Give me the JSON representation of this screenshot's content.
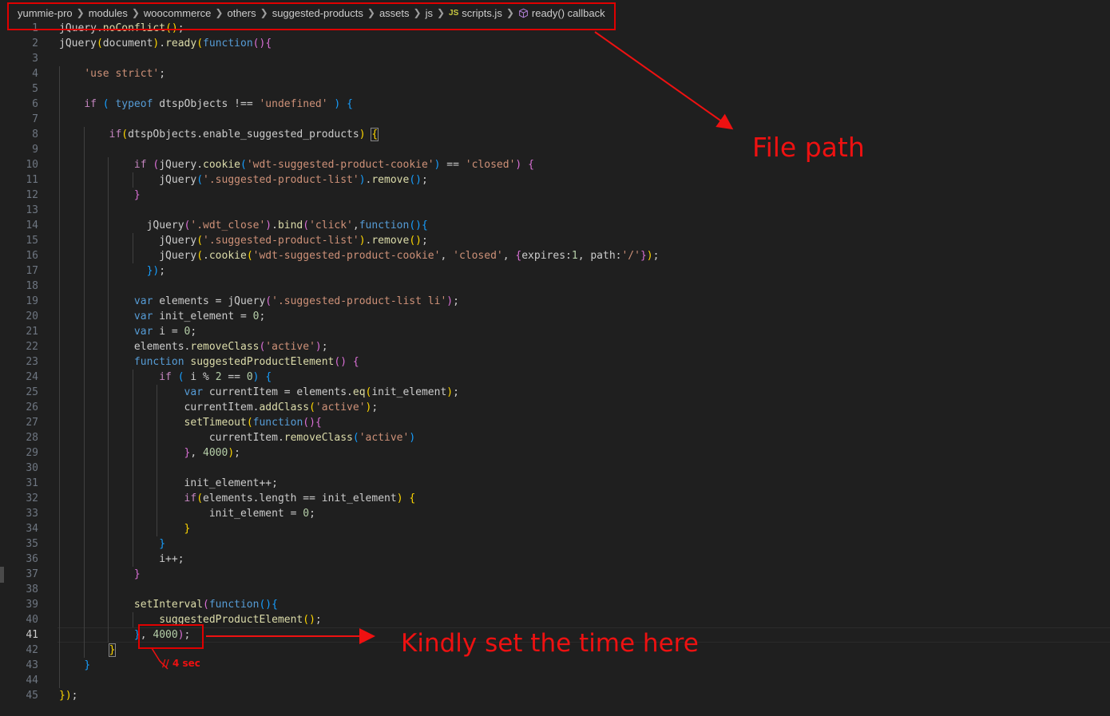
{
  "breadcrumb": {
    "items": [
      "yummie-pro",
      "modules",
      "woocommerce",
      "others",
      "suggested-products",
      "assets",
      "js"
    ],
    "file_badge": "JS",
    "file_name": "scripts.js",
    "symbol": "ready() callback"
  },
  "annotations": {
    "file_path": "File path",
    "set_time": "Kindly set the time here",
    "note": "// 4 sec",
    "color": "#ee1111"
  },
  "editor": {
    "active_line": 41,
    "lines": [
      [
        [
          "jQuery",
          ""
        ],
        [
          ".",
          ""
        ],
        [
          "noConflict",
          "f"
        ],
        [
          "()",
          "b1"
        ],
        [
          ";",
          ""
        ]
      ],
      [
        [
          "jQuery",
          ""
        ],
        [
          "(",
          "b1"
        ],
        [
          "document",
          ""
        ],
        [
          ")",
          "b1"
        ],
        [
          ".",
          ""
        ],
        [
          "ready",
          "f"
        ],
        [
          "(",
          "b1"
        ],
        [
          "function",
          "k"
        ],
        [
          "()",
          "b2"
        ],
        [
          "{",
          "b2"
        ]
      ],
      [],
      [
        [
          "    ",
          ""
        ],
        [
          "'use strict'",
          "s"
        ],
        [
          ";",
          ""
        ]
      ],
      [],
      [
        [
          "    ",
          ""
        ],
        [
          "if",
          "c"
        ],
        [
          " ",
          ""
        ],
        [
          "(",
          "b3"
        ],
        [
          " ",
          ""
        ],
        [
          "typeof",
          "k"
        ],
        [
          " dtspObjects !== ",
          ""
        ],
        [
          "'undefined'",
          "s"
        ],
        [
          " ",
          ""
        ],
        [
          ")",
          "b3"
        ],
        [
          " ",
          ""
        ],
        [
          "{",
          "b3"
        ]
      ],
      [],
      [
        [
          "        ",
          ""
        ],
        [
          "if",
          "c"
        ],
        [
          "(",
          "b1"
        ],
        [
          "dtspObjects",
          ""
        ],
        [
          ".",
          ""
        ],
        [
          "enable_suggested_products",
          ""
        ],
        [
          ")",
          "b1"
        ],
        [
          " ",
          ""
        ],
        [
          "{",
          "b1bm"
        ]
      ],
      [],
      [
        [
          "            ",
          ""
        ],
        [
          "if",
          "c"
        ],
        [
          " ",
          ""
        ],
        [
          "(",
          "b2"
        ],
        [
          "jQuery",
          ""
        ],
        [
          ".",
          ""
        ],
        [
          "cookie",
          "f"
        ],
        [
          "(",
          "b3"
        ],
        [
          "'wdt-suggested-product-cookie'",
          "s"
        ],
        [
          ")",
          "b3"
        ],
        [
          " == ",
          ""
        ],
        [
          "'closed'",
          "s"
        ],
        [
          ")",
          "b2"
        ],
        [
          " ",
          ""
        ],
        [
          "{",
          "b2"
        ]
      ],
      [
        [
          "                ",
          ""
        ],
        [
          "jQuery",
          ""
        ],
        [
          "(",
          "b3"
        ],
        [
          "'.suggested-product-list'",
          "s"
        ],
        [
          ")",
          "b3"
        ],
        [
          ".",
          ""
        ],
        [
          "remove",
          "f"
        ],
        [
          "()",
          "b3"
        ],
        [
          ";",
          ""
        ]
      ],
      [
        [
          "            ",
          ""
        ],
        [
          "}",
          "b2"
        ]
      ],
      [],
      [
        [
          "              ",
          ""
        ],
        [
          "jQuery",
          ""
        ],
        [
          "(",
          "b2"
        ],
        [
          "'.wdt_close'",
          "s"
        ],
        [
          ")",
          "b2"
        ],
        [
          ".",
          ""
        ],
        [
          "bind",
          "f"
        ],
        [
          "(",
          "b2"
        ],
        [
          "'click'",
          "s"
        ],
        [
          ",",
          ""
        ],
        [
          "function",
          "k"
        ],
        [
          "()",
          "b3"
        ],
        [
          "{",
          "b3"
        ]
      ],
      [
        [
          "                ",
          ""
        ],
        [
          "jQuery",
          ""
        ],
        [
          "(",
          "b1"
        ],
        [
          "'.suggested-product-list'",
          "s"
        ],
        [
          ")",
          "b1"
        ],
        [
          ".",
          ""
        ],
        [
          "remove",
          "f"
        ],
        [
          "()",
          "b1"
        ],
        [
          ";",
          ""
        ]
      ],
      [
        [
          "                ",
          ""
        ],
        [
          "jQuery",
          ""
        ],
        [
          "(",
          "b1"
        ],
        [
          ".",
          ""
        ],
        [
          "cookie",
          "f"
        ],
        [
          "(",
          "b1"
        ],
        [
          "'wdt-suggested-product-cookie'",
          "s"
        ],
        [
          ", ",
          ""
        ],
        [
          "'closed'",
          "s"
        ],
        [
          ", ",
          ""
        ],
        [
          "{",
          "b2"
        ],
        [
          "expires",
          ""
        ],
        [
          ":",
          ""
        ],
        [
          "1",
          "n"
        ],
        [
          ", path:",
          ""
        ],
        [
          "'/'",
          "s"
        ],
        [
          "}",
          "b2"
        ],
        [
          ")",
          "b1"
        ],
        [
          ";",
          ""
        ]
      ],
      [
        [
          "              ",
          ""
        ],
        [
          "})",
          "b3"
        ],
        [
          ";",
          ""
        ]
      ],
      [],
      [
        [
          "            ",
          ""
        ],
        [
          "var",
          "k"
        ],
        [
          " elements = ",
          ""
        ],
        [
          "jQuery",
          ""
        ],
        [
          "(",
          "b2"
        ],
        [
          "'.suggested-product-list li'",
          "s"
        ],
        [
          ")",
          "b2"
        ],
        [
          ";",
          ""
        ]
      ],
      [
        [
          "            ",
          ""
        ],
        [
          "var",
          "k"
        ],
        [
          " init_element = ",
          ""
        ],
        [
          "0",
          "n"
        ],
        [
          ";",
          ""
        ]
      ],
      [
        [
          "            ",
          ""
        ],
        [
          "var",
          "k"
        ],
        [
          " i = ",
          ""
        ],
        [
          "0",
          "n"
        ],
        [
          ";",
          ""
        ]
      ],
      [
        [
          "            ",
          ""
        ],
        [
          "elements",
          ""
        ],
        [
          ".",
          ""
        ],
        [
          "removeClass",
          "f"
        ],
        [
          "(",
          "b2"
        ],
        [
          "'active'",
          "s"
        ],
        [
          ")",
          "b2"
        ],
        [
          ";",
          ""
        ]
      ],
      [
        [
          "            ",
          ""
        ],
        [
          "function",
          "k"
        ],
        [
          " ",
          ""
        ],
        [
          "suggestedProductElement",
          "f"
        ],
        [
          "()",
          "b2"
        ],
        [
          " ",
          ""
        ],
        [
          "{",
          "b2"
        ]
      ],
      [
        [
          "                ",
          ""
        ],
        [
          "if",
          "c"
        ],
        [
          " ",
          ""
        ],
        [
          "(",
          "b3"
        ],
        [
          " i % ",
          ""
        ],
        [
          "2",
          "n"
        ],
        [
          " == ",
          ""
        ],
        [
          "0",
          "n"
        ],
        [
          ")",
          "b3"
        ],
        [
          " ",
          ""
        ],
        [
          "{",
          "b3"
        ]
      ],
      [
        [
          "                    ",
          ""
        ],
        [
          "var",
          "k"
        ],
        [
          " currentItem = elements",
          ""
        ],
        [
          ".",
          ""
        ],
        [
          "eq",
          "f"
        ],
        [
          "(",
          "b1"
        ],
        [
          "init_element",
          ""
        ],
        [
          ")",
          "b1"
        ],
        [
          ";",
          ""
        ]
      ],
      [
        [
          "                    ",
          ""
        ],
        [
          "currentItem",
          ""
        ],
        [
          ".",
          ""
        ],
        [
          "addClass",
          "f"
        ],
        [
          "(",
          "b1"
        ],
        [
          "'active'",
          "s"
        ],
        [
          ")",
          "b1"
        ],
        [
          ";",
          ""
        ]
      ],
      [
        [
          "                    ",
          ""
        ],
        [
          "setTimeout",
          "f"
        ],
        [
          "(",
          "b1"
        ],
        [
          "function",
          "k"
        ],
        [
          "()",
          "b2"
        ],
        [
          "{",
          "b2"
        ]
      ],
      [
        [
          "                        ",
          ""
        ],
        [
          "currentItem",
          ""
        ],
        [
          ".",
          ""
        ],
        [
          "removeClass",
          "f"
        ],
        [
          "(",
          "b3"
        ],
        [
          "'active'",
          "s"
        ],
        [
          ")",
          "b3"
        ]
      ],
      [
        [
          "                    ",
          ""
        ],
        [
          "}",
          "b2"
        ],
        [
          ", ",
          ""
        ],
        [
          "4000",
          "n"
        ],
        [
          ")",
          "b1"
        ],
        [
          ";",
          ""
        ]
      ],
      [],
      [
        [
          "                    ",
          ""
        ],
        [
          "init_element++",
          ""
        ],
        [
          ";",
          ""
        ]
      ],
      [
        [
          "                    ",
          ""
        ],
        [
          "if",
          "c"
        ],
        [
          "(",
          "b1"
        ],
        [
          "elements",
          ""
        ],
        [
          ".",
          ""
        ],
        [
          "length",
          ""
        ],
        [
          " == init_element",
          ""
        ],
        [
          ")",
          "b1"
        ],
        [
          " ",
          ""
        ],
        [
          "{",
          "b1"
        ]
      ],
      [
        [
          "                        ",
          ""
        ],
        [
          "init_element = ",
          ""
        ],
        [
          "0",
          "n"
        ],
        [
          ";",
          ""
        ]
      ],
      [
        [
          "                    ",
          ""
        ],
        [
          "}",
          "b1"
        ]
      ],
      [
        [
          "                ",
          ""
        ],
        [
          "}",
          "b3"
        ]
      ],
      [
        [
          "                ",
          ""
        ],
        [
          "i++",
          ""
        ],
        [
          ";",
          ""
        ]
      ],
      [
        [
          "            ",
          ""
        ],
        [
          "}",
          "b2"
        ]
      ],
      [],
      [
        [
          "            ",
          ""
        ],
        [
          "setInterval",
          "f"
        ],
        [
          "(",
          "b2"
        ],
        [
          "function",
          "k"
        ],
        [
          "()",
          "b3"
        ],
        [
          "{",
          "b3"
        ]
      ],
      [
        [
          "                ",
          ""
        ],
        [
          "suggestedProductElement",
          "f"
        ],
        [
          "()",
          "b1"
        ],
        [
          ";",
          ""
        ]
      ],
      [
        [
          "            ",
          ""
        ],
        [
          "}",
          "b3"
        ],
        [
          ", ",
          ""
        ],
        [
          "4000",
          "n"
        ],
        [
          ")",
          "b2"
        ],
        [
          ";",
          ""
        ]
      ],
      [
        [
          "        ",
          ""
        ],
        [
          "}",
          "b1bm"
        ]
      ],
      [
        [
          "    ",
          ""
        ],
        [
          "}",
          "b3"
        ]
      ],
      [],
      [
        [
          "})",
          "b1"
        ],
        [
          ";",
          ""
        ]
      ]
    ]
  }
}
